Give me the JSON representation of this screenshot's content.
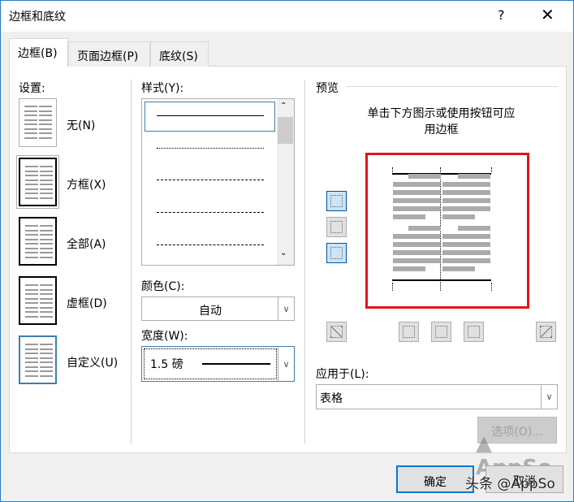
{
  "window": {
    "title": "边框和底纹",
    "help": "?",
    "close": "✕"
  },
  "tabs": [
    {
      "label": "边框(B)",
      "active": true
    },
    {
      "label": "页面边框(P)"
    },
    {
      "label": "底纹(S)"
    }
  ],
  "settings": {
    "label": "设置:",
    "items": [
      {
        "label": "无(N)"
      },
      {
        "label": "方框(X)"
      },
      {
        "label": "全部(A)"
      },
      {
        "label": "虚框(D)"
      },
      {
        "label": "自定义(U)",
        "selected": true
      }
    ]
  },
  "style": {
    "label": "样式(Y):",
    "options": [
      "solid",
      "dotted",
      "dashed-small",
      "dashed",
      "dash-dot"
    ],
    "selected": "solid"
  },
  "color": {
    "label": "颜色(C):",
    "value": "自动"
  },
  "width": {
    "label": "宽度(W):",
    "value": "1.5 磅"
  },
  "preview": {
    "label": "预览",
    "hint_line1": "单击下方图示或使用按钮可应",
    "hint_line2": "用边框",
    "highlight_color": "#e0141e"
  },
  "apply_to": {
    "label": "应用于(L):",
    "value": "表格"
  },
  "buttons": {
    "options": "选项(O)...",
    "ok": "确定",
    "cancel": "取消"
  },
  "watermark": {
    "logo": "AppSo",
    "text": "头条 @AppSo"
  }
}
